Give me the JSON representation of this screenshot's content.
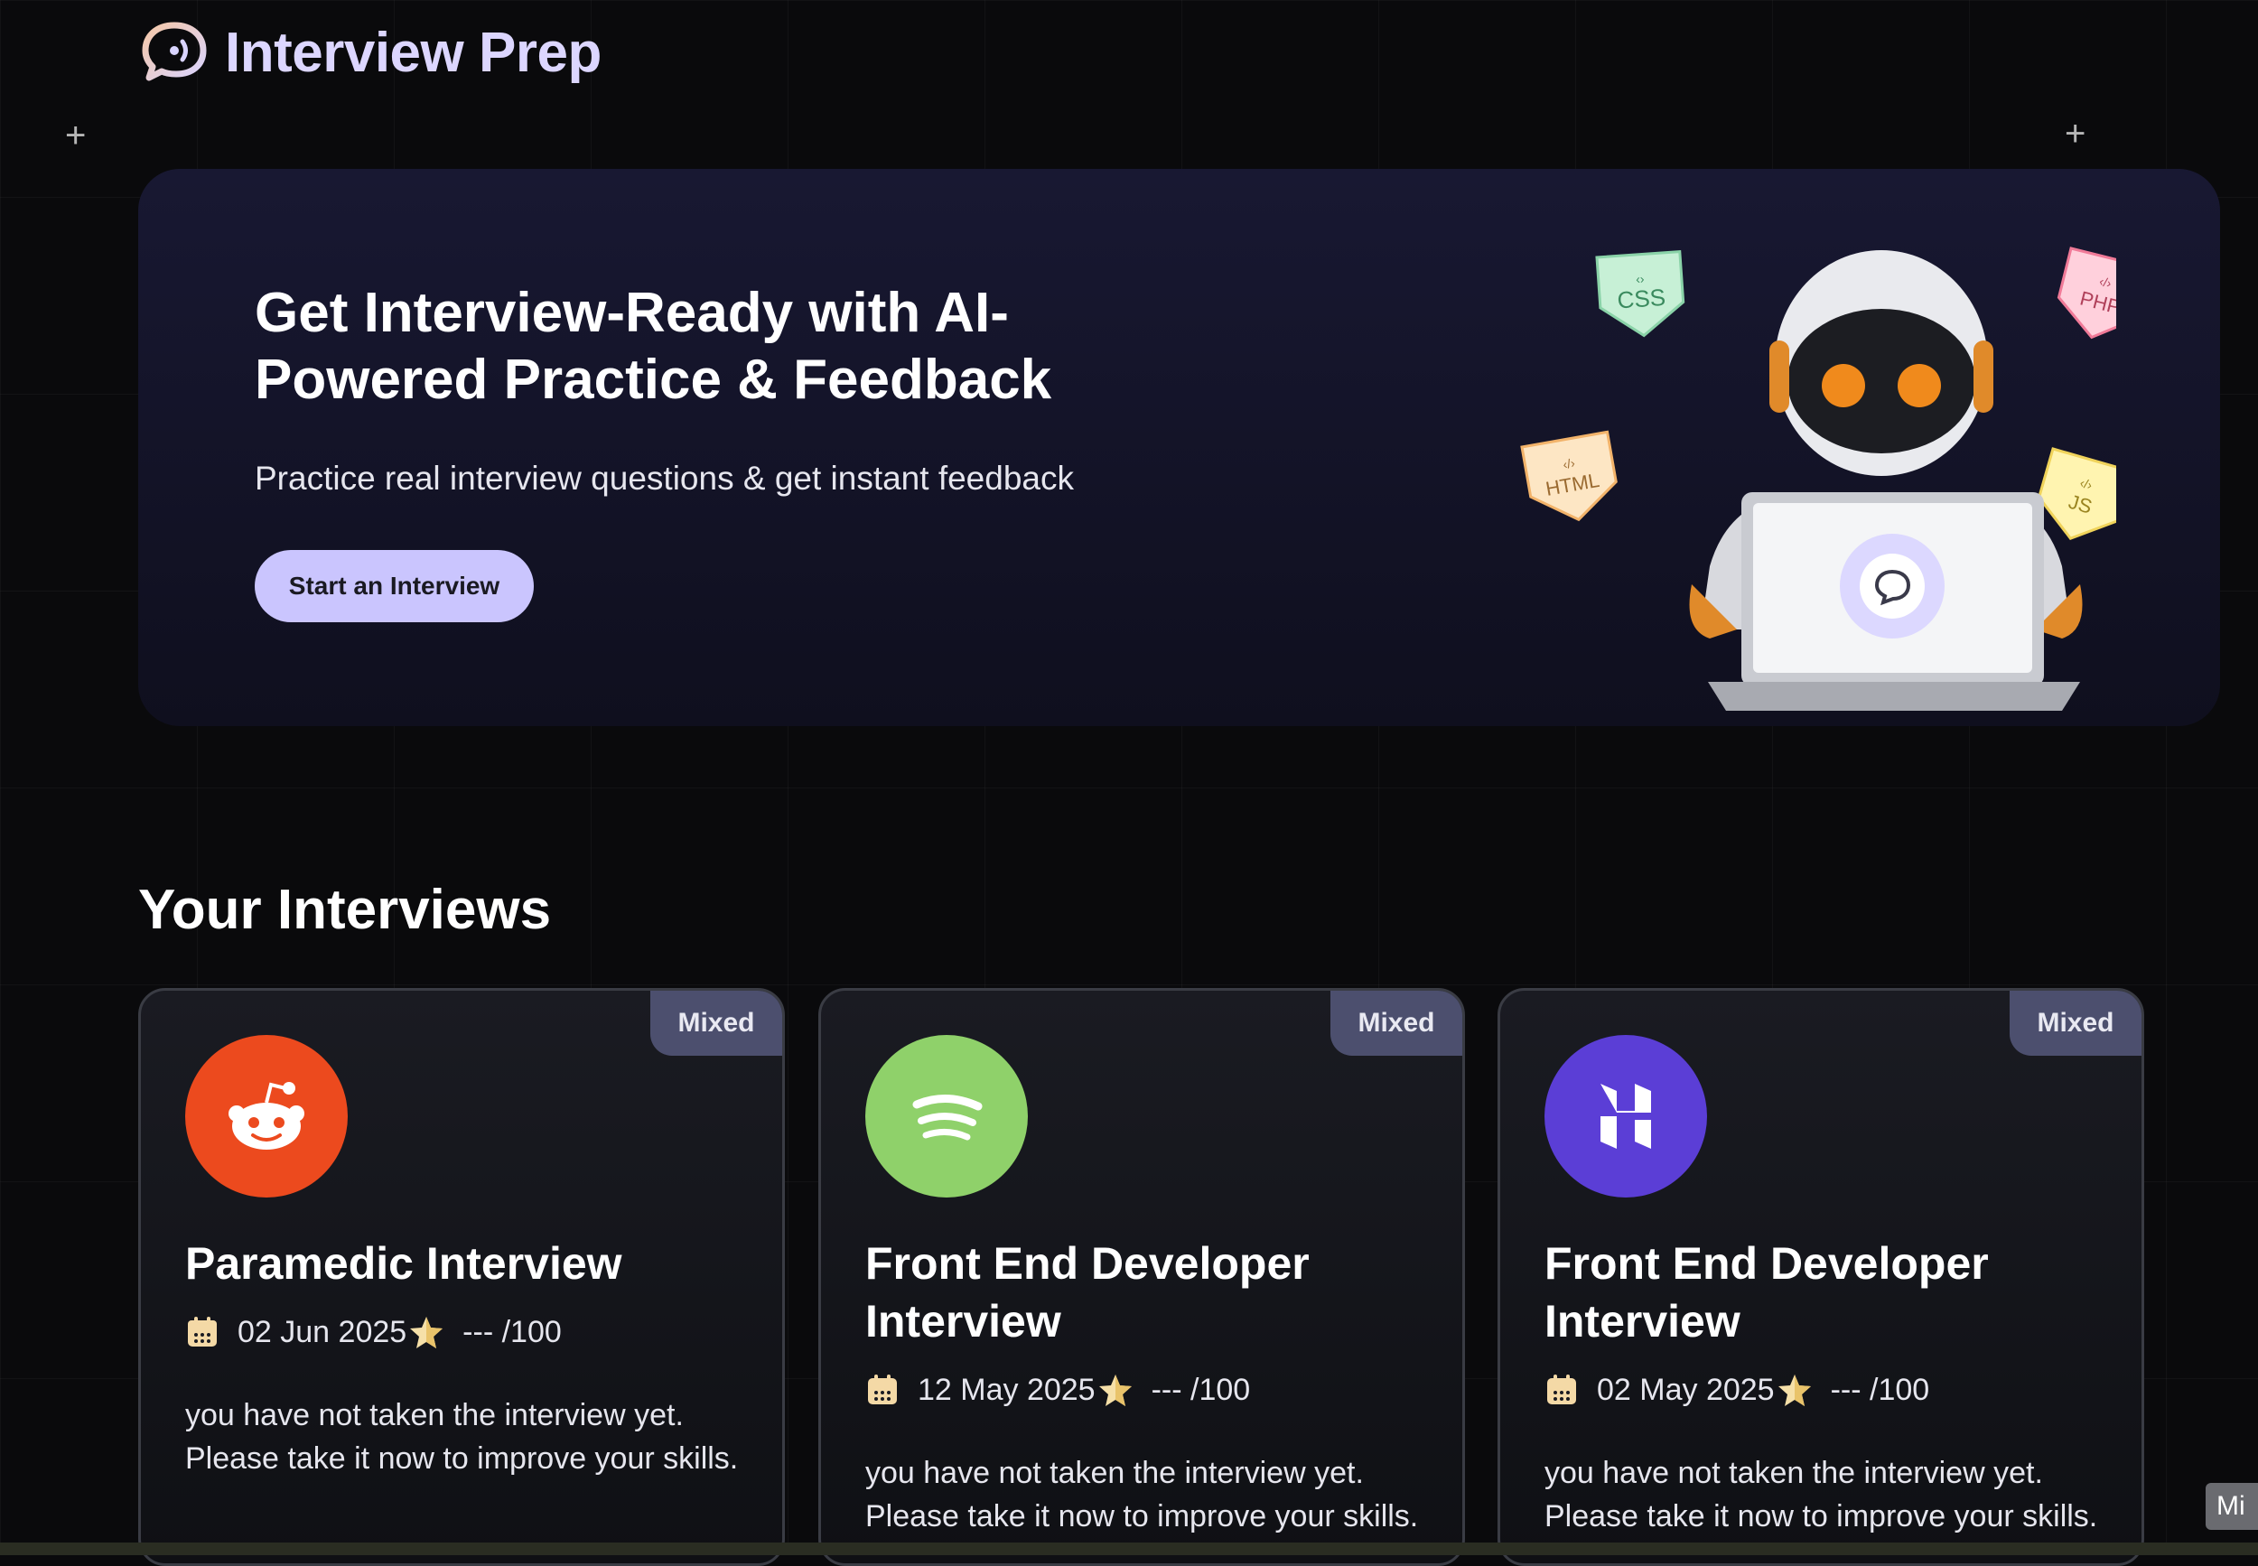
{
  "header": {
    "title": "Interview Prep",
    "logo_icon": "chat-bubble-icon"
  },
  "hero": {
    "title": "Get Interview-Ready with AI-Powered Practice & Feedback",
    "subtitle": "Practice real interview questions & get instant feedback",
    "cta_label": "Start an Interview",
    "tags": [
      "CSS",
      "PHP",
      "HTML",
      "JS"
    ]
  },
  "section": {
    "title": "Your Interviews"
  },
  "interviews": [
    {
      "badge": "Mixed",
      "logo": "reddit-logo-icon",
      "logo_color": "#ec4a1e",
      "title": "Paramedic Interview",
      "date": "02 Jun 2025",
      "score": "--- /100",
      "description": "you have not taken the interview yet. Please take it now to improve your skills."
    },
    {
      "badge": "Mixed",
      "logo": "spotify-logo-icon",
      "logo_color": "#8fd16a",
      "title": "Front End Developer Interview",
      "date": "12 May 2025",
      "score": "--- /100",
      "description": "you have not taken the interview yet. Please take it now to improve your skills."
    },
    {
      "badge": "Mixed",
      "logo": "hostinger-logo-icon",
      "logo_color": "#5b3ed6",
      "title": "Front End Developer Interview",
      "date": "02 May 2025",
      "score": "--- /100",
      "description": "you have not taken the interview yet. Please take it now to improve your skills."
    }
  ],
  "corner_chip": "Mi",
  "colors": {
    "accent": "#cac5fe",
    "hero_bg": "#181832",
    "badge_bg": "#4c4f6e"
  }
}
